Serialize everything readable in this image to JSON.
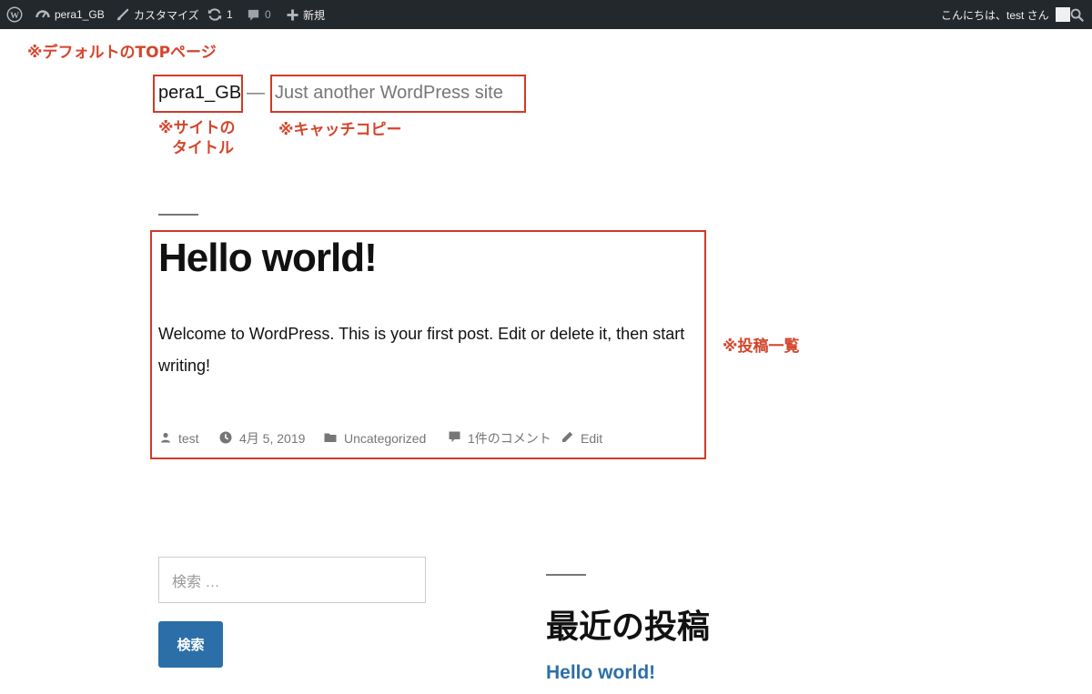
{
  "adminbar": {
    "site_name": "pera1_GB",
    "customize": "カスタマイズ",
    "updates_count": "1",
    "comments_count": "0",
    "new": "新規",
    "greeting": "こんにちは、test さん"
  },
  "annotations": {
    "page_label": "※デフォルトのTOPページ",
    "site_title_line1": "※サイトの",
    "site_title_line2": "タイトル",
    "tagline": "※キャッチコピー",
    "post_list": "※投稿一覧"
  },
  "site": {
    "title": "pera1_GB",
    "separator": "—",
    "description": "Just another WordPress site"
  },
  "post": {
    "title": "Hello world!",
    "excerpt": "Welcome to WordPress. This is your first post. Edit or delete it, then start writing!",
    "meta": {
      "author": "test",
      "date": "4月 5, 2019",
      "category": "Uncategorized",
      "comments": "1件のコメント",
      "edit": "Edit"
    }
  },
  "widgets": {
    "search_placeholder": "検索 …",
    "search_button": "検索",
    "recent_title": "最近の投稿",
    "recent_items": [
      "Hello world!"
    ]
  },
  "colors": {
    "adminbar_bg": "#23282d",
    "annotation": "#d23a26",
    "link": "#2c6fa8",
    "muted": "#767676"
  },
  "icons": [
    "wordpress-logo-icon",
    "dashboard-icon",
    "brush-icon",
    "updates-icon",
    "comment-icon",
    "plus-icon",
    "avatar",
    "search-icon",
    "author-icon",
    "clock-icon",
    "folder-icon",
    "comment-bubble-icon",
    "pencil-icon"
  ]
}
